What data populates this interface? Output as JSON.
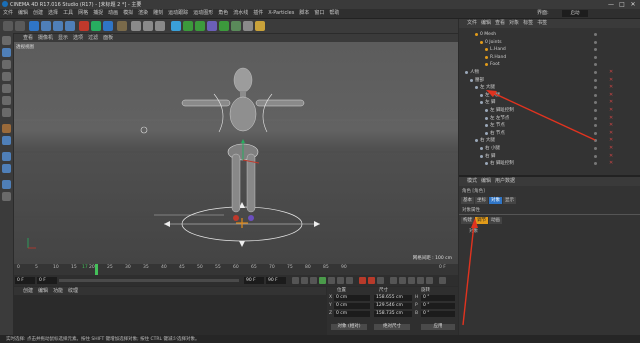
{
  "window": {
    "title": "CINEMA 4D R17.016 Studio (R17) - [未标题 2 *] - 主要",
    "controls": [
      "—",
      "□",
      "✕"
    ]
  },
  "menubar": {
    "items": [
      "文件",
      "编辑",
      "创建",
      "选择",
      "工具",
      "网格",
      "捕捉",
      "动画",
      "模拟",
      "渲染",
      "雕刻",
      "运动跟踪",
      "运动图形",
      "角色",
      "流水线",
      "插件",
      "X-Particles",
      "脚本",
      "窗口",
      "帮助"
    ],
    "layout_label": "界面:",
    "layout_value": "启动"
  },
  "viewport": {
    "menu": [
      "查看",
      "摄像机",
      "显示",
      "选项",
      "过滤",
      "面板"
    ],
    "label": "透视视图",
    "grid_spacing": "网格间距 : 100 cm"
  },
  "timeline": {
    "ticks": [
      "0",
      "5",
      "10",
      "15",
      "17",
      "20",
      "25",
      "30",
      "35",
      "40",
      "45",
      "50",
      "55",
      "60",
      "65",
      "70",
      "75",
      "80",
      "85",
      "90"
    ],
    "end_label": "0 F",
    "current_frame": 17
  },
  "playback": {
    "start": "0 F",
    "current": "0 F",
    "end": "90 F",
    "end2": "90 F"
  },
  "materials": {
    "menu": [
      "创建",
      "编辑",
      "功能",
      "纹理"
    ]
  },
  "coordinates": {
    "headers": [
      "位置",
      "尺寸",
      "旋转"
    ],
    "position": [
      "0 cm",
      "0 cm",
      "0 cm"
    ],
    "size": [
      "158.655 cm",
      "129.546 cm",
      "158.735 cm"
    ],
    "rotation": [
      "0 °",
      "0 °",
      "0 °"
    ],
    "axes": [
      "X",
      "Y",
      "Z"
    ],
    "rot_axes": [
      "H",
      "P",
      "B"
    ],
    "mode_select": "对象 (相对)",
    "size_select": "绝对尺寸",
    "apply": "应用"
  },
  "object_manager": {
    "menu": [
      "文件",
      "编辑",
      "查看",
      "对象",
      "标签",
      "书签"
    ],
    "rows": [
      {
        "name": "0 Mesh",
        "indent": 2
      },
      {
        "name": "0 Joints",
        "indent": 3
      },
      {
        "name": "L.Hand",
        "indent": 4
      },
      {
        "name": "R.Hand",
        "indent": 4
      },
      {
        "name": "Foot",
        "indent": 4
      },
      {
        "name": "人物",
        "indent": 0
      },
      {
        "name": "腰部",
        "indent": 1
      },
      {
        "name": "左 大腿",
        "indent": 2
      },
      {
        "name": "左 小腿",
        "indent": 3
      },
      {
        "name": "左 脚",
        "indent": 3
      },
      {
        "name": "左 脚趾控制",
        "indent": 4
      },
      {
        "name": "左 左节点",
        "indent": 4
      },
      {
        "name": "左 节点",
        "indent": 4
      },
      {
        "name": "右 节点",
        "indent": 4
      },
      {
        "name": "右 大腿",
        "indent": 2
      },
      {
        "name": "右 小腿",
        "indent": 3
      },
      {
        "name": "右 脚",
        "indent": 3
      },
      {
        "name": "右 脚趾控制",
        "indent": 4
      }
    ]
  },
  "attribute_manager": {
    "menu": [
      "模式",
      "编辑",
      "用户数据"
    ],
    "object_type": "角色 [角色]",
    "tabs": [
      "基本",
      "坐标",
      "对象",
      "显示"
    ],
    "section": "对象属性",
    "subtabs": [
      "构建",
      "调节",
      "动画"
    ],
    "field_label": "对象"
  },
  "statusbar": {
    "text": "实时选择: 点击并拖动鼠标选择元素。按住 SHIFT 键增加选择对象; 按住 CTRL 键减少选择对象。"
  },
  "colors": {
    "accent_blue": "#2f75c6",
    "highlight_orange": "#e29b19",
    "annotation_red": "#e0331f",
    "timeline_green": "#44c05a"
  }
}
